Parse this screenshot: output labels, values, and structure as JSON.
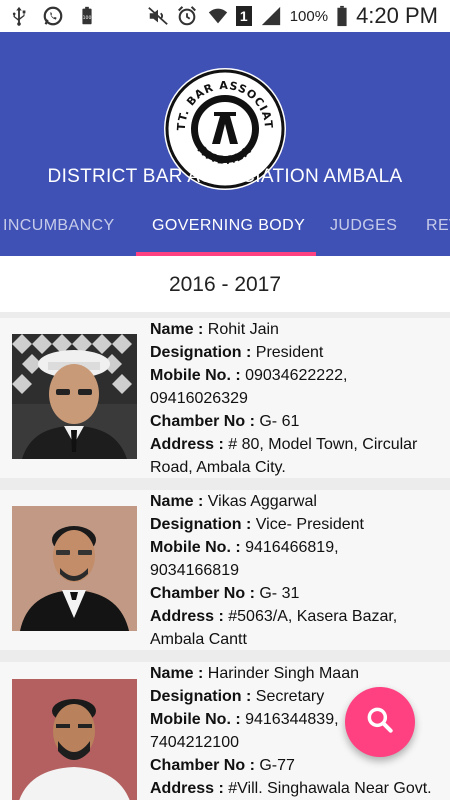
{
  "status_bar": {
    "battery_percent": "100%",
    "time": "4:20 PM",
    "sim_label": "1",
    "icons": [
      "usb-icon",
      "whatsapp-icon",
      "battery-notification-icon",
      "mute-icon",
      "alarm-icon",
      "wifi-icon",
      "signal-icon",
      "battery-icon"
    ]
  },
  "header": {
    "logo_top_text": "DISTT. BAR ASSOCIATION",
    "logo_bottom_text": "AMBALA",
    "title": "DISTRICT BAR ASSOCIATION AMBALA",
    "tabs": [
      {
        "label": "INCUMBANCY"
      },
      {
        "label": "GOVERNING BODY"
      },
      {
        "label": "JUDGES"
      },
      {
        "label": "REV"
      }
    ],
    "active_tab": "GOVERNING BODY"
  },
  "year": "2016 - 2017",
  "labels": {
    "name": "Name : ",
    "designation": "Designation : ",
    "mobile": "Mobile No. : ",
    "chamber": "Chamber No : ",
    "address": "Address : "
  },
  "members": [
    {
      "name": "Rohit Jain",
      "designation": "President",
      "mobile_line1": "09034622222,",
      "mobile_line2": "09416026329",
      "chamber": "G- 61",
      "address_line1": "# 80, Model Town, Circular",
      "address_line2": "Road, Ambala City."
    },
    {
      "name": "Vikas Aggarwal",
      "designation": "Vice- President",
      "mobile_line1": "9416466819,",
      "mobile_line2": "9034166819",
      "chamber": "G- 31",
      "address_line1": "#5063/A, Kasera Bazar,",
      "address_line2": "Ambala Cantt"
    },
    {
      "name": "Harinder Singh Maan",
      "designation": "Secretary",
      "mobile_line1": "9416344839,",
      "mobile_line2": "7404212100",
      "chamber": "G-77",
      "address_line1": "#Vill. Singhawala Near Govt.",
      "address_line2": ""
    }
  ],
  "colors": {
    "app_bar": "#3f51b5",
    "tab_indicator": "#ff4081",
    "fab": "#ff4081"
  },
  "fab_icon": "search-icon"
}
